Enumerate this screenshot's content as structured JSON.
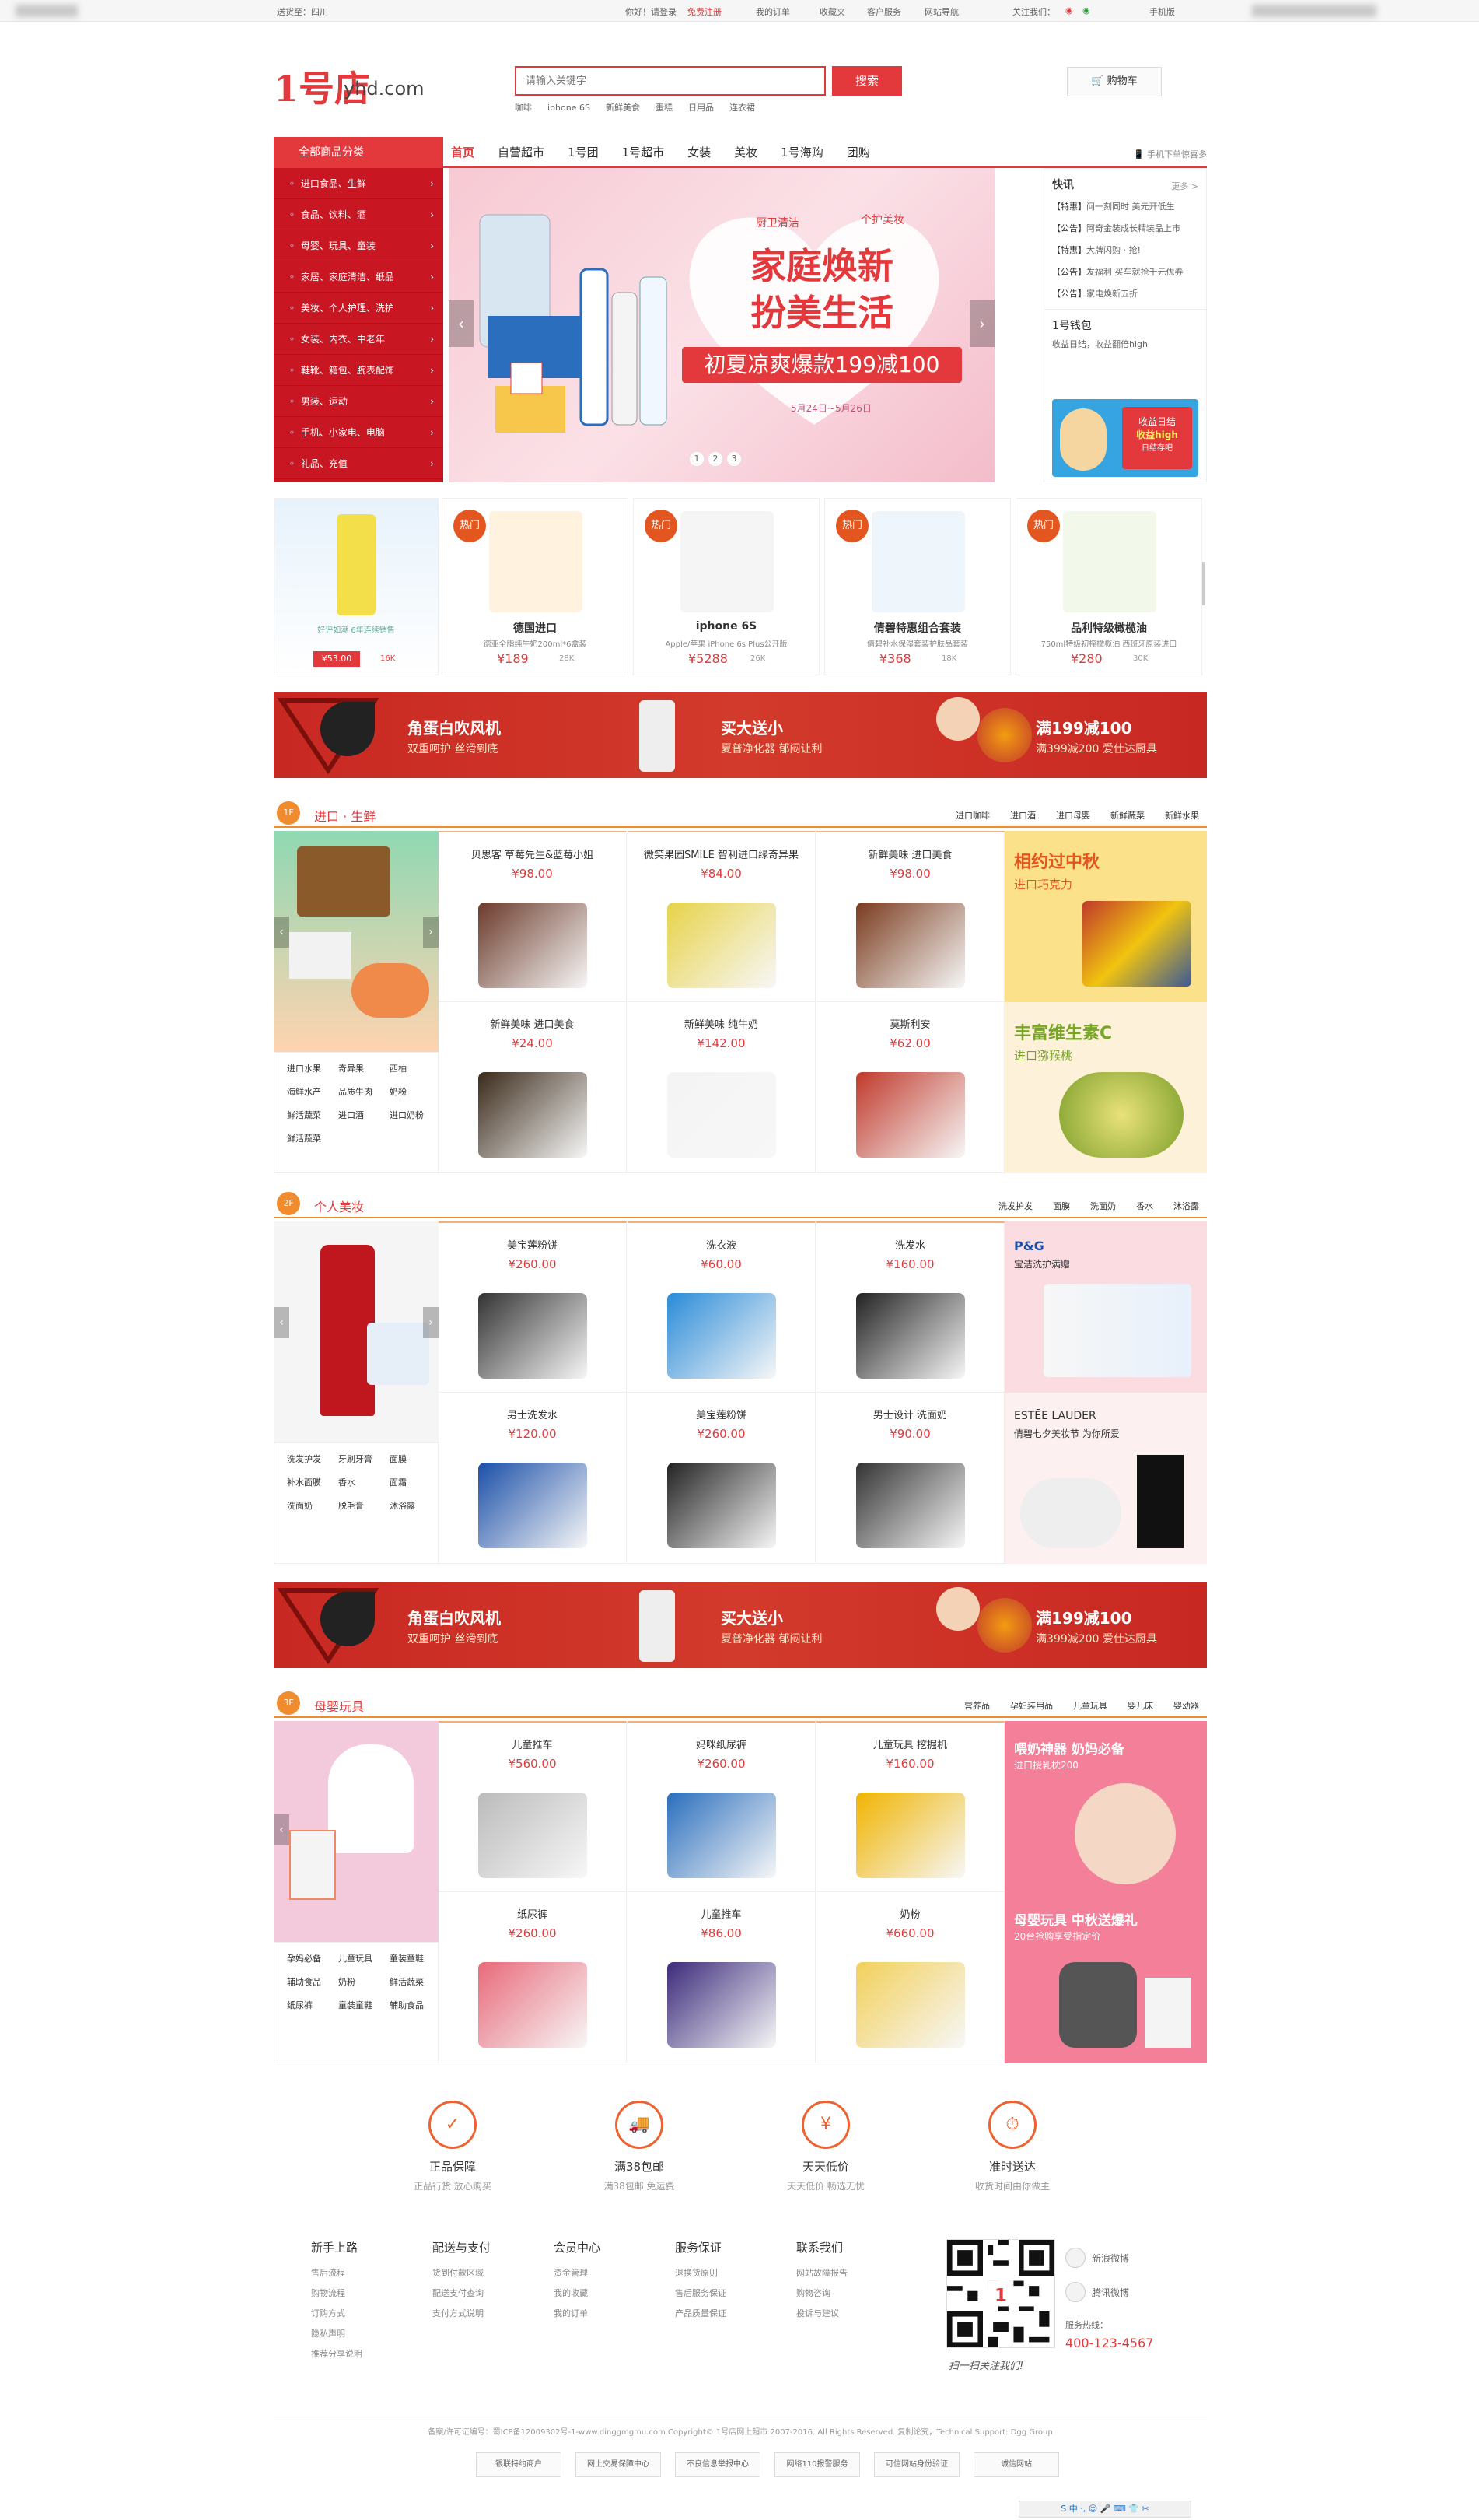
{
  "topbar": {
    "location": "送货至：四川",
    "hello": "你好！请登录",
    "register": "免费注册",
    "orders": "我的订单",
    "favorites": "收藏夹",
    "service": "客户服务",
    "sitenav": "网站导航",
    "follow": "关注我们：",
    "mobile": "手机版"
  },
  "header": {
    "logo_num": "1号店",
    "logo_domain": "yhd.com",
    "search_placeholder": "请输入关键字",
    "search_btn": "搜索",
    "hot_words": [
      "咖啡",
      "iphone 6S",
      "新鲜美食",
      "蛋糕",
      "日用品",
      "连衣裙"
    ],
    "cart": "购物车"
  },
  "nav": {
    "all_cat": "全部商品分类",
    "items": [
      "首页",
      "自营超市",
      "1号团",
      "1号超市",
      "女装",
      "美妆",
      "1号海购",
      "团购"
    ],
    "phone": "手机下单惊喜多"
  },
  "categories": [
    "进口食品、生鲜",
    "食品、饮料、酒",
    "母婴、玩具、童装",
    "家居、家庭清洁、纸品",
    "美妆、个人护理、洗护",
    "女装、内衣、中老年",
    "鞋靴、箱包、腕表配饰",
    "男装、运动",
    "手机、小家电、电脑",
    "礼品、充值"
  ],
  "banner": {
    "tag1": "厨卫清洁",
    "tag2": "个护美妆",
    "title1": "家庭焕新",
    "title2": "扮美生活",
    "sub": "初夏凉爽爆款199减100",
    "date": "5月24日~5月26日",
    "dots": [
      "1",
      "2",
      "3"
    ]
  },
  "news": {
    "title": "快讯",
    "more": "更多 >",
    "items": [
      {
        "tag": "【特惠】",
        "text": "问一刻同时 美元开低生"
      },
      {
        "tag": "【公告】",
        "text": "阿奇金装成长精装品上市"
      },
      {
        "tag": "【特惠】",
        "text": "大牌闪购 · 抢!"
      },
      {
        "tag": "【公告】",
        "text": "发福利 买车就抢千元优券"
      },
      {
        "tag": "【公告】",
        "text": "家电焕新五折"
      }
    ],
    "wallet": "1号钱包",
    "wallet_sub": "收益日结，收益翻倍high",
    "wallet_badge1": "收益日结",
    "wallet_badge2": "收益high",
    "wallet_badge3": "日结存吧"
  },
  "hot_products": [
    {
      "badge": "",
      "name": "",
      "desc": "好评如潮 6年连续销售",
      "price": "¥53.00",
      "count": "16K"
    },
    {
      "badge": "热门",
      "name": "德国进口",
      "desc": "德亚全脂纯牛奶200ml*6盒装",
      "price": "¥189",
      "count": "28K"
    },
    {
      "badge": "热门",
      "name": "iphone 6S",
      "desc": "Apple/苹果 iPhone 6s Plus公开版",
      "price": "¥5288",
      "count": "26K"
    },
    {
      "badge": "热门",
      "name": "倩碧特惠组合套装",
      "desc": "倩碧补水保湿套装护肤品套装",
      "price": "¥368",
      "count": "18K"
    },
    {
      "badge": "热门",
      "name": "品利特级橄榄油",
      "desc": "750ml特级初榨橄榄油 西班牙原装进口",
      "price": "¥280",
      "count": "30K"
    }
  ],
  "ads": {
    "a1": "角蛋白吹风机",
    "a1s": "双重呵护  丝滑到底",
    "a2": "买大送小",
    "a2s": "夏普净化器  郁闷让利",
    "a3": "满199减100",
    "a3s": "满399减200  爱仕达厨具"
  },
  "floor1": {
    "num": "1F",
    "title": "进口 · 生鲜",
    "tabs": [
      "进口咖啡",
      "进口酒",
      "进口母婴",
      "新鲜蔬菜",
      "新鲜水果"
    ],
    "links": [
      "进口水果",
      "奇异果",
      "西柚",
      "海鲜水产",
      "品质牛肉",
      "奶粉",
      "鲜活蔬菜",
      "进口酒",
      "进口奶粉",
      "鲜活蔬菜"
    ],
    "cells": [
      {
        "name": "贝思客 草莓先生&蓝莓小姐",
        "price": "¥98.00"
      },
      {
        "name": "微笑果园SMILE 智利进口绿奇异果",
        "price": "¥84.00"
      },
      {
        "name": "新鲜美味 进口美食",
        "price": "¥98.00"
      },
      {
        "name": "新鲜美味 进口美食",
        "price": "¥24.00"
      },
      {
        "name": "新鲜美味 纯牛奶",
        "price": "¥142.00"
      },
      {
        "name": "莫斯利安",
        "price": "¥62.00"
      }
    ],
    "promo1a": "相约过中秋",
    "promo1b": "进口巧克力",
    "promo2a": "丰富维生素C",
    "promo2b": "进口猕猴桃"
  },
  "floor2": {
    "num": "2F",
    "title": "个人美妆",
    "tabs": [
      "洗发护发",
      "面膜",
      "洗面奶",
      "香水",
      "沐浴露"
    ],
    "links": [
      "洗发护发",
      "牙刷牙膏",
      "面膜",
      "补水面膜",
      "香水",
      "面霜",
      "洗面奶",
      "脱毛膏",
      "沐浴露"
    ],
    "cells": [
      {
        "name": "美宝莲粉饼",
        "price": "¥260.00"
      },
      {
        "name": "洗衣液",
        "price": "¥60.00"
      },
      {
        "name": "洗发水",
        "price": "¥160.00"
      },
      {
        "name": "男士洗发水",
        "price": "¥120.00"
      },
      {
        "name": "美宝莲粉饼",
        "price": "¥260.00"
      },
      {
        "name": "男士设计 洗面奶",
        "price": "¥90.00"
      }
    ],
    "promo1a": "P&G",
    "promo1b": "宝洁洗护满赠",
    "promo2a": "ESTĒE LAUDER",
    "promo2b": "倩碧七夕美妆节 为你所爱"
  },
  "floor3": {
    "num": "3F",
    "title": "母婴玩具",
    "tabs": [
      "营养品",
      "孕妇装用品",
      "儿童玩具",
      "婴儿床",
      "婴幼器"
    ],
    "links": [
      "孕妈必备",
      "儿童玩具",
      "童装童鞋",
      "辅助食品",
      "奶粉",
      "鲜活蔬菜",
      "纸尿裤",
      "童装童鞋",
      "辅助食品"
    ],
    "cells": [
      {
        "name": "儿童推车",
        "price": "¥560.00"
      },
      {
        "name": "妈咪纸尿裤",
        "price": "¥260.00"
      },
      {
        "name": "儿童玩具 挖掘机",
        "price": "¥160.00"
      },
      {
        "name": "纸尿裤",
        "price": "¥260.00"
      },
      {
        "name": "儿童推车",
        "price": "¥86.00"
      },
      {
        "name": "奶粉",
        "price": "¥660.00"
      }
    ],
    "promo1a": "喂奶神器  奶妈必备",
    "promo1b": "进口授乳枕200",
    "promo2a": "母婴玩具 中秋送爆礼",
    "promo2b": "20台抢购享受指定价"
  },
  "services": [
    {
      "icon": "medal-icon",
      "a": "正品保障",
      "b": "正品行货 放心购买"
    },
    {
      "icon": "truck-icon",
      "a": "满38包邮",
      "b": "满38包邮 免运费"
    },
    {
      "icon": "sale-icon",
      "a": "天天低价",
      "b": "天天低价 畅选无忧"
    },
    {
      "icon": "clock-icon",
      "a": "准时送达",
      "b": "收货时间由你做主"
    }
  ],
  "footer": {
    "cols": [
      {
        "h": "新手上路",
        "items": [
          "售后流程",
          "购物流程",
          "订购方式",
          "隐私声明",
          "推荐分享说明"
        ]
      },
      {
        "h": "配送与支付",
        "items": [
          "货到付款区域",
          "配送支付查询",
          "支付方式说明"
        ]
      },
      {
        "h": "会员中心",
        "items": [
          "资金管理",
          "我的收藏",
          "我的订单"
        ]
      },
      {
        "h": "服务保证",
        "items": [
          "退换货原则",
          "售后服务保证",
          "产品质量保证"
        ]
      },
      {
        "h": "联系我们",
        "items": [
          "网站故障报告",
          "购物咨询",
          "投诉与建议"
        ]
      }
    ],
    "qr_text": "扫一扫关注我们!",
    "weibo": "新浪微博",
    "tweibo": "腾讯微博",
    "hotline": "服务热线：",
    "hotnum": "400-123-4567",
    "copyright": "备案/许可证编号：蜀ICP备12009302号-1-www.dinggmgmu.com Copyright© 1号店网上超市 2007-2016. All Rights Reserved. 复制论究，Technical Support: Dgg Group",
    "badges": [
      "银联特约商户",
      "网上交易保障中心",
      "不良信息举报中心",
      "网络110报警服务",
      "可信网站身份验证",
      "诚信网站"
    ],
    "tray": "S 中 ·, ☺ 🎤 ⌨ 👕 ✂"
  }
}
